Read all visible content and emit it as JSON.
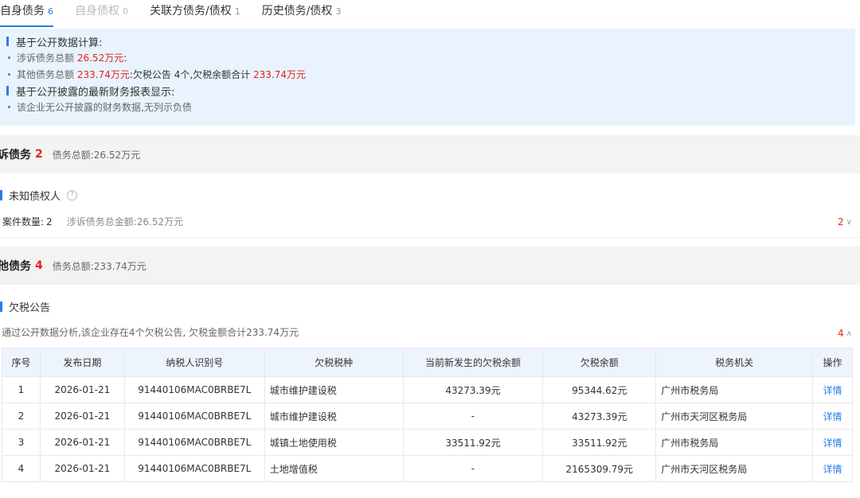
{
  "tabs": [
    {
      "label": "自身债务",
      "count": "6",
      "state": "active"
    },
    {
      "label": "自身债权",
      "count": "0",
      "state": "disabled"
    },
    {
      "label": "关联方债务/债权",
      "count": "1",
      "state": "normal"
    },
    {
      "label": "历史债务/债权",
      "count": "3",
      "state": "normal"
    }
  ],
  "summary": {
    "head1": "基于公开数据计算:",
    "line1_prefix": "涉诉债务总额",
    "line1_amount": "26.52万元",
    "line1_suffix": ":",
    "line2_prefix": "其他债务总额",
    "line2_amount": "233.74万元",
    "line2_mid": ":欠税公告 4个,欠税余额合计",
    "line2_amount2": "233.74万元",
    "head2": "基于公开披露的最新财务报表显示:",
    "line3": "该企业无公开披露的财务数据,无列示负债"
  },
  "litigation": {
    "title": "诉债务",
    "count": "2",
    "total": "债务总额:26.52万元",
    "sub_title": "未知债权人",
    "help_icon": "?",
    "case_label": "案件数量:",
    "case_value": "2",
    "case_total": "涉诉债务总金额:26.52万元",
    "toggle": "2"
  },
  "other": {
    "title": "他债务",
    "count": "4",
    "total": "债务总额:233.74万元",
    "sub_title": "欠税公告",
    "desc": "通过公开数据分析,该企业存在4个欠税公告, 欠税金额合计233.74万元",
    "toggle": "4"
  },
  "table": {
    "headers": [
      "序号",
      "发布日期",
      "纳税人识别号",
      "欠税税种",
      "当前新发生的欠税余额",
      "欠税余额",
      "税务机关",
      "操作"
    ],
    "rows": [
      [
        "1",
        "2026-01-21",
        "91440106MAC0BRBE7L",
        "城市维护建设税",
        "43273.39元",
        "95344.62元",
        "广州市税务局",
        "详情"
      ],
      [
        "2",
        "2026-01-21",
        "91440106MAC0BRBE7L",
        "城市维护建设税",
        "-",
        "43273.39元",
        "广州市天河区税务局",
        "详情"
      ],
      [
        "3",
        "2026-01-21",
        "91440106MAC0BRBE7L",
        "城镇土地使用税",
        "33511.92元",
        "33511.92元",
        "广州市税务局",
        "详情"
      ],
      [
        "4",
        "2026-01-21",
        "91440106MAC0BRBE7L",
        "土地增值税",
        "-",
        "2165309.79元",
        "广州市天河区税务局",
        "详情"
      ]
    ]
  },
  "colors": {
    "accent": "#2b7bea",
    "danger": "#e2231a",
    "summary_bg": "#e9f3fd",
    "section_bg": "#f3f3f3"
  }
}
